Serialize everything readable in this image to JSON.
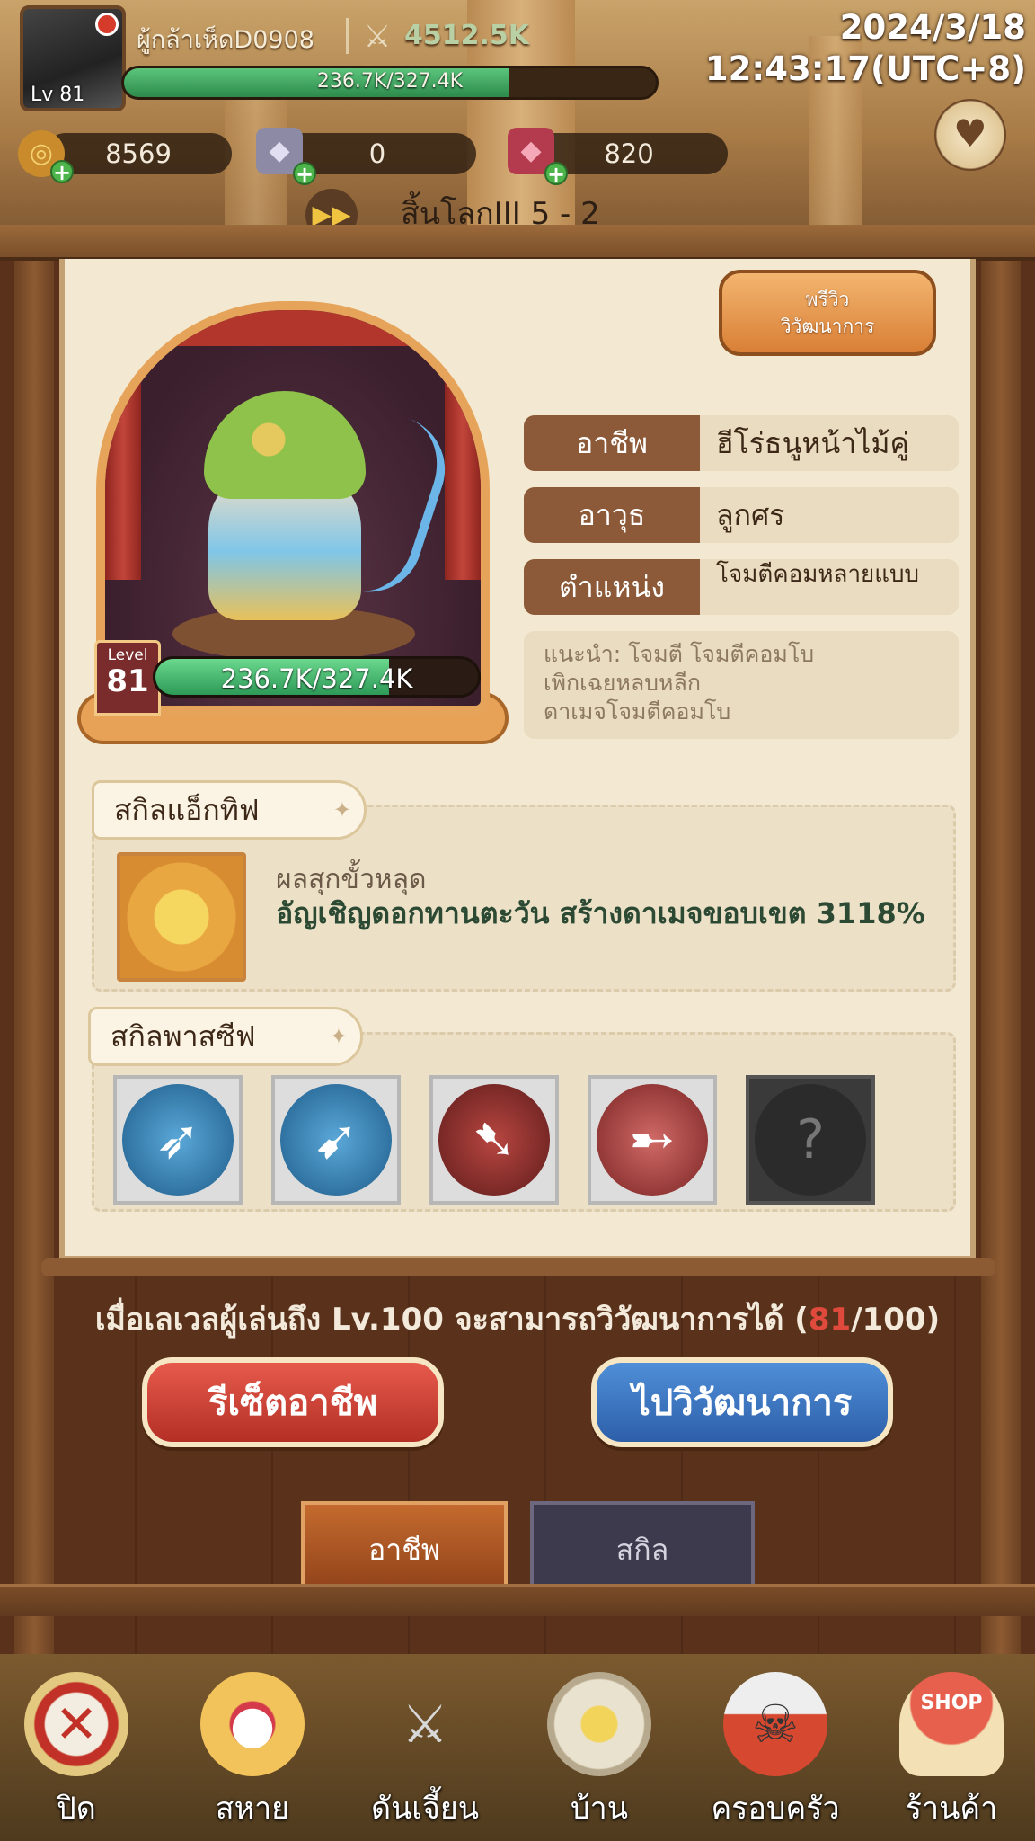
{
  "player": {
    "name": "ผู้กล้าเห็ดD0908",
    "level_text": "Lv 81",
    "power": "4512.5K",
    "xp_text": "236.7K/327.4K",
    "xp_progress": 0.723
  },
  "datetime": {
    "date": "2024/3/18",
    "time": "12:43:17(UTC+8)"
  },
  "currencies": [
    {
      "icon": "gold-coin-icon",
      "value": "8569"
    },
    {
      "icon": "crystal-icon",
      "value": "0"
    },
    {
      "icon": "ruby-gem-icon",
      "value": "820"
    }
  ],
  "stage": {
    "label": "สิ้นโลกIII 5 - 2"
  },
  "character": {
    "level_label": "Level",
    "level": "81",
    "xp_text": "236.7K/327.4K",
    "xp_progress": 0.723,
    "preview_button": "พรีวิว\nวิวัฒนาการ"
  },
  "info": {
    "job_label": "อาชีพ",
    "job_value": "ฮีโร่ธนูหน้าไม้คู่",
    "weapon_label": "อาวุธ",
    "weapon_value": "ลูกศร",
    "position_label": "ตำแหน่ง",
    "position_value": "โจมตีคอมหลายแบบ",
    "hint": "แนะนำ: โจมตี โจมตีคอมโบ\nเพิกเฉยหลบหลีก\nดาเมจโจมตีคอมโบ"
  },
  "active_skill": {
    "section": "สกิลแอ็กทิฟ",
    "name": "ผลสุกขั้วหลุด",
    "desc": "อัญเชิญดอกทานตะวัน สร้างดาเมจขอบเขต 3118%",
    "icon": "sunflower-skill-icon"
  },
  "passive_skills": {
    "section": "สกิลพาสซีฟ",
    "icons": [
      "multi-arrow-icon",
      "crossbow-icon",
      "flame-arrow-icon",
      "crimson-arrow-icon",
      "locked-question-icon"
    ]
  },
  "requirement": {
    "text": "เมื่อเลเวลผู้เล่นถึง Lv.100 จะสามารถวิวัฒนาการได้ (",
    "current": "81",
    "rest": "/100)"
  },
  "buttons": {
    "reset": "รีเซ็ตอาชีพ",
    "evolve": "ไปวิวัฒนาการ"
  },
  "tabs": [
    {
      "label": "อาชีพ",
      "active": true
    },
    {
      "label": "สกิล",
      "active": false
    }
  ],
  "nav": [
    {
      "label": "ปิด",
      "icon": "close-icon"
    },
    {
      "label": "สหาย",
      "icon": "paw-icon"
    },
    {
      "label": "ดันเจี้ยน",
      "icon": "crossed-swords-icon"
    },
    {
      "label": "บ้าน",
      "icon": "home-tower-icon"
    },
    {
      "label": "ครอบครัว",
      "icon": "skull-banner-icon"
    },
    {
      "label": "ร้านค้า",
      "icon": "shop-icon"
    }
  ],
  "colors": {
    "accent_orange": "#e6a35a",
    "button_red": "#c8372b",
    "button_blue": "#3b70bf",
    "xp_green": "#3fae63"
  }
}
